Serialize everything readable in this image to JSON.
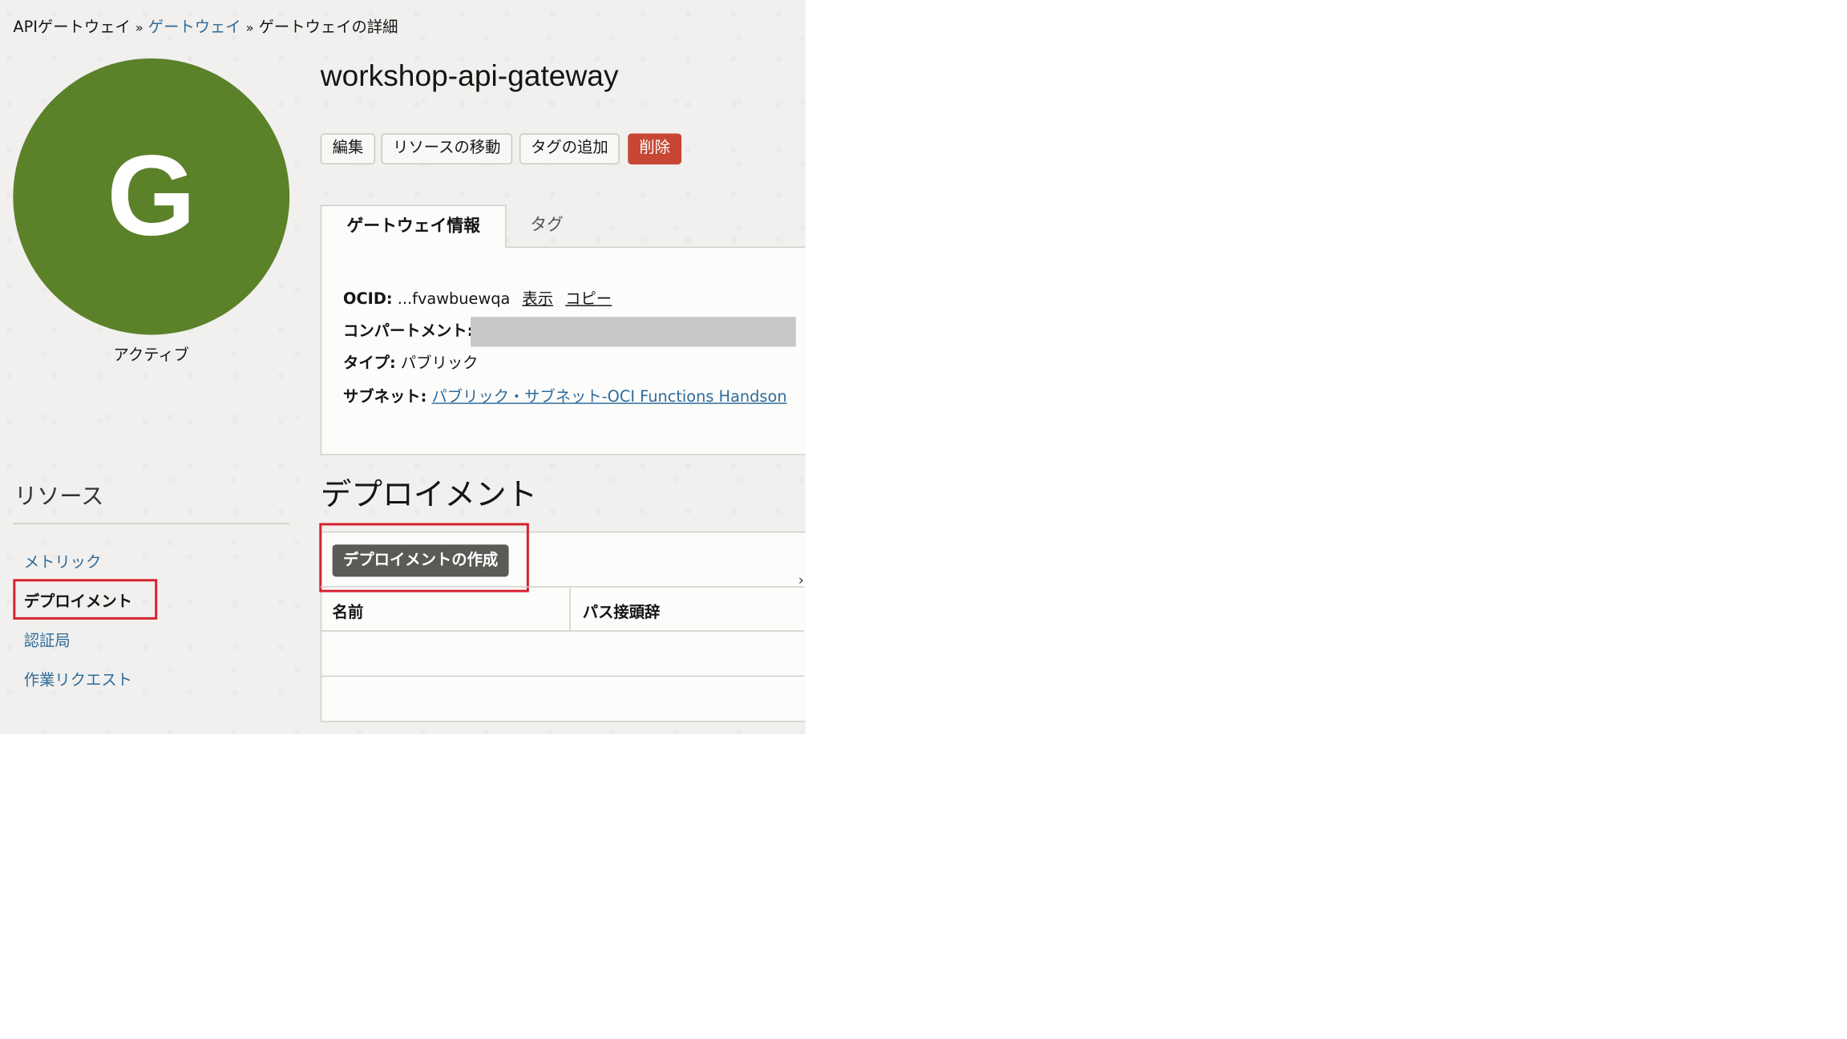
{
  "breadcrumb": {
    "items": [
      "APIゲートウェイ",
      "ゲートウェイ",
      "ゲートウェイの詳細"
    ],
    "separator": "»"
  },
  "avatar": {
    "letter": "G",
    "color": "#5b8129"
  },
  "status": "アクティブ",
  "title": "workshop-api-gateway",
  "actions": {
    "edit": "編集",
    "move_resource": "リソースの移動",
    "add_tags": "タグの追加",
    "delete": "削除"
  },
  "tabs": {
    "info": "ゲートウェイ情報",
    "tags": "タグ"
  },
  "info": {
    "ocid_label": "OCID:",
    "ocid_value": "...fvawbuewqa",
    "show_link": "表示",
    "copy_link": "コピー",
    "compartment_label": "コンパートメント:",
    "type_label": "タイプ:",
    "type_value": "パブリック",
    "subnet_label": "サブネット:",
    "subnet_value": "パブリック・サブネット-OCI Functions Handson"
  },
  "resources": {
    "heading": "リソース",
    "items": [
      "メトリック",
      "デプロイメント",
      "認証局",
      "作業リクエスト"
    ],
    "selected": "デプロイメント"
  },
  "deployments": {
    "heading": "デプロイメント",
    "create_button": "デプロイメントの作成",
    "columns": [
      "名前",
      "パス接頭辞"
    ]
  },
  "colors": {
    "accent_link": "#2f6b9a",
    "danger": "#c74634",
    "highlight": "#d6212f",
    "primary_button": "#5c5a57"
  },
  "icons": {
    "breadcrumb_separator": "double-chevron-right-icon",
    "scroll_hint": "chevron-right-icon"
  }
}
